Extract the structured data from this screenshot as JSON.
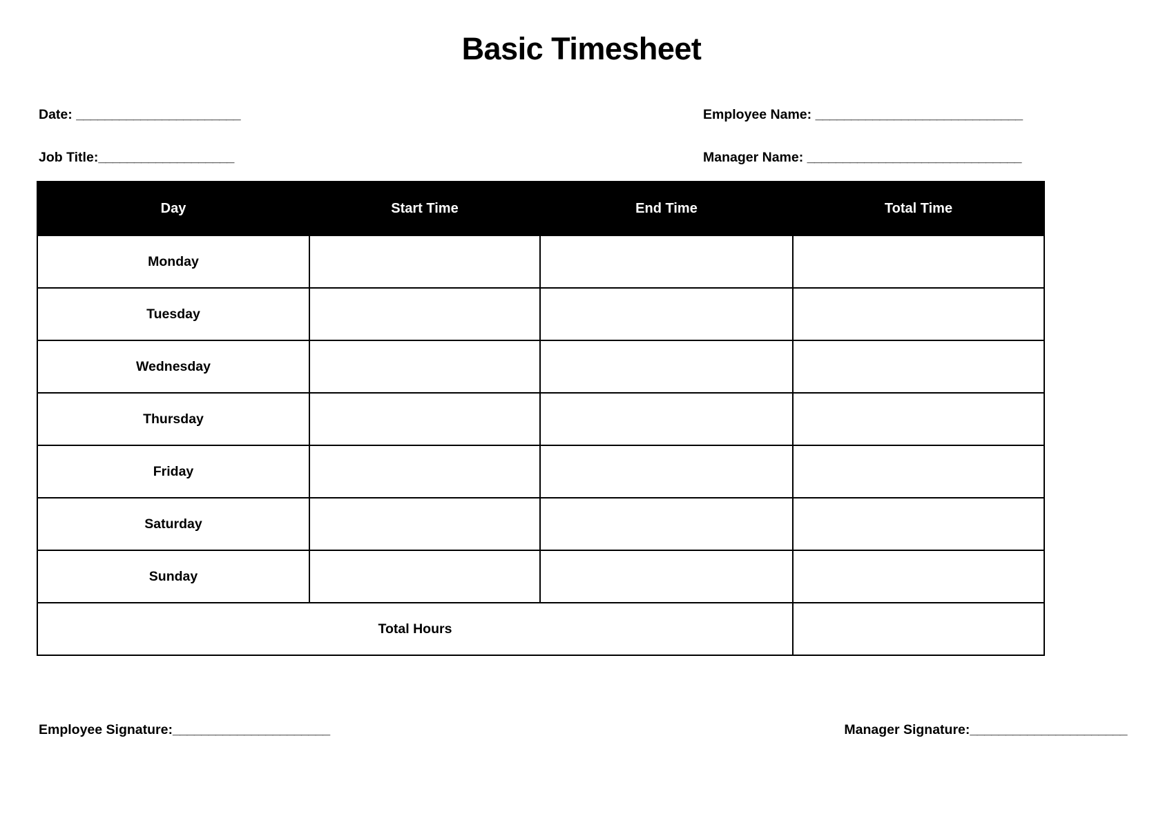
{
  "document": {
    "title": "Basic Timesheet"
  },
  "fields": {
    "date_label": "Date: ",
    "date_rule": "_______________________",
    "job_title_label": "Job Title:",
    "job_title_rule": "___________________",
    "employee_name_label": "Employee Name: ",
    "employee_name_rule": "_____________________________",
    "manager_name_label": "Manager Name: ",
    "manager_name_rule": "______________________________"
  },
  "table": {
    "headers": [
      "Day",
      "Start Time",
      "End Time",
      "Total Time"
    ],
    "rows": [
      {
        "day": "Monday",
        "start_time": "",
        "end_time": "",
        "total_time": ""
      },
      {
        "day": "Tuesday",
        "start_time": "",
        "end_time": "",
        "total_time": ""
      },
      {
        "day": "Wednesday",
        "start_time": "",
        "end_time": "",
        "total_time": ""
      },
      {
        "day": "Thursday",
        "start_time": "",
        "end_time": "",
        "total_time": ""
      },
      {
        "day": "Friday",
        "start_time": "",
        "end_time": "",
        "total_time": ""
      },
      {
        "day": "Saturday",
        "start_time": "",
        "end_time": "",
        "total_time": ""
      },
      {
        "day": "Sunday",
        "start_time": "",
        "end_time": "",
        "total_time": ""
      }
    ],
    "footer": {
      "label": "Total Hours",
      "total_value": ""
    }
  },
  "signatures": {
    "employee_label": "Employee Signature:",
    "employee_rule": "______________________",
    "manager_label": "Manager Signature:",
    "manager_rule": "______________________"
  },
  "colors": {
    "header_background": "#000000",
    "header_text": "#ffffff",
    "border": "#000000",
    "page_background": "#ffffff",
    "text": "#000000"
  }
}
